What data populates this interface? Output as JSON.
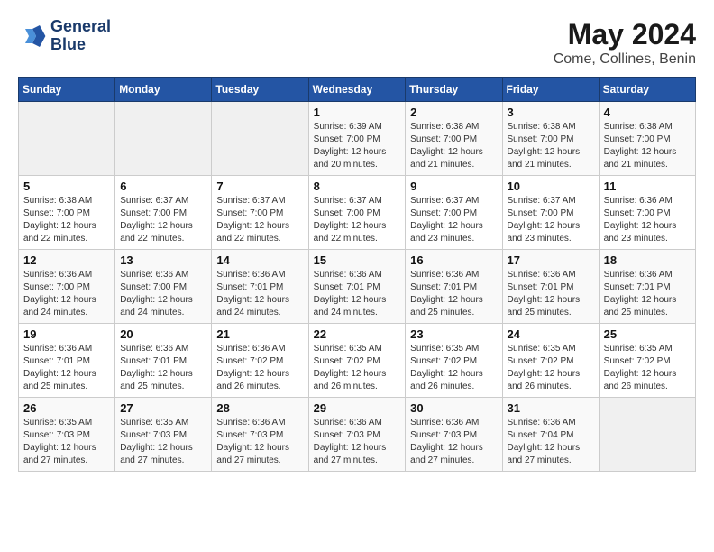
{
  "header": {
    "logo_line1": "General",
    "logo_line2": "Blue",
    "month_year": "May 2024",
    "location": "Come, Collines, Benin"
  },
  "days_of_week": [
    "Sunday",
    "Monday",
    "Tuesday",
    "Wednesday",
    "Thursday",
    "Friday",
    "Saturday"
  ],
  "weeks": [
    [
      {
        "day": "",
        "info": ""
      },
      {
        "day": "",
        "info": ""
      },
      {
        "day": "",
        "info": ""
      },
      {
        "day": "1",
        "sunrise": "6:39 AM",
        "sunset": "7:00 PM",
        "daylight": "12 hours and 20 minutes."
      },
      {
        "day": "2",
        "sunrise": "6:38 AM",
        "sunset": "7:00 PM",
        "daylight": "12 hours and 21 minutes."
      },
      {
        "day": "3",
        "sunrise": "6:38 AM",
        "sunset": "7:00 PM",
        "daylight": "12 hours and 21 minutes."
      },
      {
        "day": "4",
        "sunrise": "6:38 AM",
        "sunset": "7:00 PM",
        "daylight": "12 hours and 21 minutes."
      }
    ],
    [
      {
        "day": "5",
        "sunrise": "6:38 AM",
        "sunset": "7:00 PM",
        "daylight": "12 hours and 22 minutes."
      },
      {
        "day": "6",
        "sunrise": "6:37 AM",
        "sunset": "7:00 PM",
        "daylight": "12 hours and 22 minutes."
      },
      {
        "day": "7",
        "sunrise": "6:37 AM",
        "sunset": "7:00 PM",
        "daylight": "12 hours and 22 minutes."
      },
      {
        "day": "8",
        "sunrise": "6:37 AM",
        "sunset": "7:00 PM",
        "daylight": "12 hours and 22 minutes."
      },
      {
        "day": "9",
        "sunrise": "6:37 AM",
        "sunset": "7:00 PM",
        "daylight": "12 hours and 23 minutes."
      },
      {
        "day": "10",
        "sunrise": "6:37 AM",
        "sunset": "7:00 PM",
        "daylight": "12 hours and 23 minutes."
      },
      {
        "day": "11",
        "sunrise": "6:36 AM",
        "sunset": "7:00 PM",
        "daylight": "12 hours and 23 minutes."
      }
    ],
    [
      {
        "day": "12",
        "sunrise": "6:36 AM",
        "sunset": "7:00 PM",
        "daylight": "12 hours and 24 minutes."
      },
      {
        "day": "13",
        "sunrise": "6:36 AM",
        "sunset": "7:00 PM",
        "daylight": "12 hours and 24 minutes."
      },
      {
        "day": "14",
        "sunrise": "6:36 AM",
        "sunset": "7:01 PM",
        "daylight": "12 hours and 24 minutes."
      },
      {
        "day": "15",
        "sunrise": "6:36 AM",
        "sunset": "7:01 PM",
        "daylight": "12 hours and 24 minutes."
      },
      {
        "day": "16",
        "sunrise": "6:36 AM",
        "sunset": "7:01 PM",
        "daylight": "12 hours and 25 minutes."
      },
      {
        "day": "17",
        "sunrise": "6:36 AM",
        "sunset": "7:01 PM",
        "daylight": "12 hours and 25 minutes."
      },
      {
        "day": "18",
        "sunrise": "6:36 AM",
        "sunset": "7:01 PM",
        "daylight": "12 hours and 25 minutes."
      }
    ],
    [
      {
        "day": "19",
        "sunrise": "6:36 AM",
        "sunset": "7:01 PM",
        "daylight": "12 hours and 25 minutes."
      },
      {
        "day": "20",
        "sunrise": "6:36 AM",
        "sunset": "7:01 PM",
        "daylight": "12 hours and 25 minutes."
      },
      {
        "day": "21",
        "sunrise": "6:36 AM",
        "sunset": "7:02 PM",
        "daylight": "12 hours and 26 minutes."
      },
      {
        "day": "22",
        "sunrise": "6:35 AM",
        "sunset": "7:02 PM",
        "daylight": "12 hours and 26 minutes."
      },
      {
        "day": "23",
        "sunrise": "6:35 AM",
        "sunset": "7:02 PM",
        "daylight": "12 hours and 26 minutes."
      },
      {
        "day": "24",
        "sunrise": "6:35 AM",
        "sunset": "7:02 PM",
        "daylight": "12 hours and 26 minutes."
      },
      {
        "day": "25",
        "sunrise": "6:35 AM",
        "sunset": "7:02 PM",
        "daylight": "12 hours and 26 minutes."
      }
    ],
    [
      {
        "day": "26",
        "sunrise": "6:35 AM",
        "sunset": "7:03 PM",
        "daylight": "12 hours and 27 minutes."
      },
      {
        "day": "27",
        "sunrise": "6:35 AM",
        "sunset": "7:03 PM",
        "daylight": "12 hours and 27 minutes."
      },
      {
        "day": "28",
        "sunrise": "6:36 AM",
        "sunset": "7:03 PM",
        "daylight": "12 hours and 27 minutes."
      },
      {
        "day": "29",
        "sunrise": "6:36 AM",
        "sunset": "7:03 PM",
        "daylight": "12 hours and 27 minutes."
      },
      {
        "day": "30",
        "sunrise": "6:36 AM",
        "sunset": "7:03 PM",
        "daylight": "12 hours and 27 minutes."
      },
      {
        "day": "31",
        "sunrise": "6:36 AM",
        "sunset": "7:04 PM",
        "daylight": "12 hours and 27 minutes."
      },
      {
        "day": "",
        "info": ""
      }
    ]
  ]
}
